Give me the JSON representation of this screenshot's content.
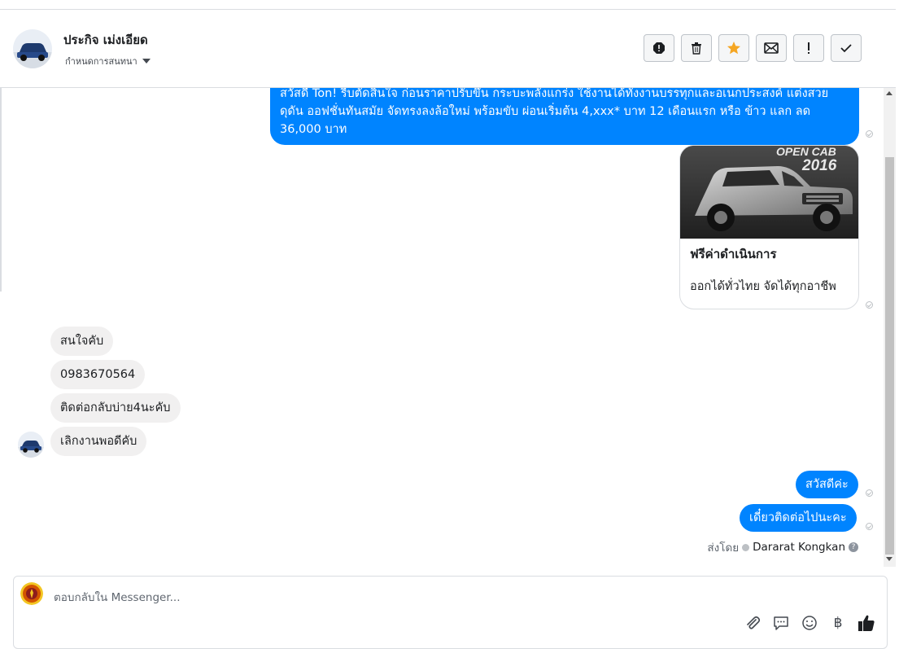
{
  "header": {
    "contact_name": "ประกิจ เม่งเอียด",
    "assign_label": "กำหนดการสนทนา",
    "actions": [
      "spam-icon",
      "trash-icon",
      "star-icon",
      "mail-icon",
      "follow-up-icon",
      "done-icon"
    ],
    "accent": "#f5a623"
  },
  "messages": {
    "outgoing_promo": "สวัสดี Ton! รีบตัดสินใจ ก่อนราคาปรับขึ้น กระบะพลังแกร่ง ใช้งานได้ทั้งงานบรรทุกและอเนกประสงค์ แต่งสวยดุดัน ออฟชั่นทันสมัย จัดทรงลงล้อใหม่ พร้อมขับ ผ่อนเริ่มต้น 4,xxx* บาท 12 เดือนแรก หรือ ข้าว แลก ลด 36,000 บาท",
    "card": {
      "image_caption": "OPEN CAB",
      "image_year": "2016",
      "title": "ฟรีค่าดำเนินการ",
      "subtitle": "ออกได้ทั่วไทย จัดได้ทุกอาชีพ"
    },
    "incoming": [
      "สนใจคับ",
      "0983670564",
      "ติดต่อกลับบ่าย4นะคับ",
      "เลิกงานพอดีคับ"
    ],
    "outgoing": [
      "สวัสดีค่ะ",
      "เดี๋ยวติดต่อไปนะคะ"
    ],
    "sent_by_prefix": "ส่งโดย",
    "sent_by_name": "Dararat Kongkan",
    "bubble_color": "#0084ff"
  },
  "composer": {
    "placeholder": "ตอบกลับใน Messenger...",
    "tools": [
      "attach-icon",
      "saved-reply-icon",
      "emoji-icon",
      "payment-icon",
      "like-icon"
    ],
    "baht_symbol": "฿"
  }
}
